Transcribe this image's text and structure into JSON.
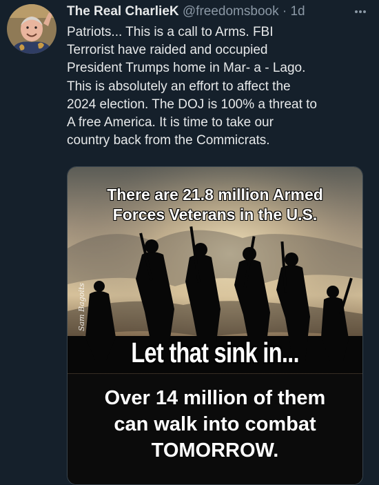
{
  "tweet": {
    "author": {
      "display_name": "The Real CharlieK",
      "handle": "@freedomsbook",
      "separator": "·",
      "timestamp": "1d"
    },
    "text": "Patriots... This is a call to Arms. FBI\nTerrorist have raided and occupied\nPresident Trumps home in Mar- a - Lago.\nThis is absolutely an effort to affect the\n2024 election. The DOJ is 100% a threat to\nA free America. It is time to take our\ncountry back from the Commicrats.",
    "media": {
      "headline_line1": "There are 21.8 million Armed",
      "headline_line2": "Forces Veterans in the U.S.",
      "slogan": "Let that sink in...",
      "caption_line1": "Over 14 million of them",
      "caption_line2": "can walk into combat",
      "caption_line3": "TOMORROW.",
      "watermark": "Sam Bagoits"
    }
  },
  "icons": {
    "more": "more-horizontal-icon"
  },
  "colors": {
    "background": "#15202b",
    "primary_text": "#e7e9ea",
    "secondary_text": "#8b98a5",
    "card_border": "#38444d"
  }
}
